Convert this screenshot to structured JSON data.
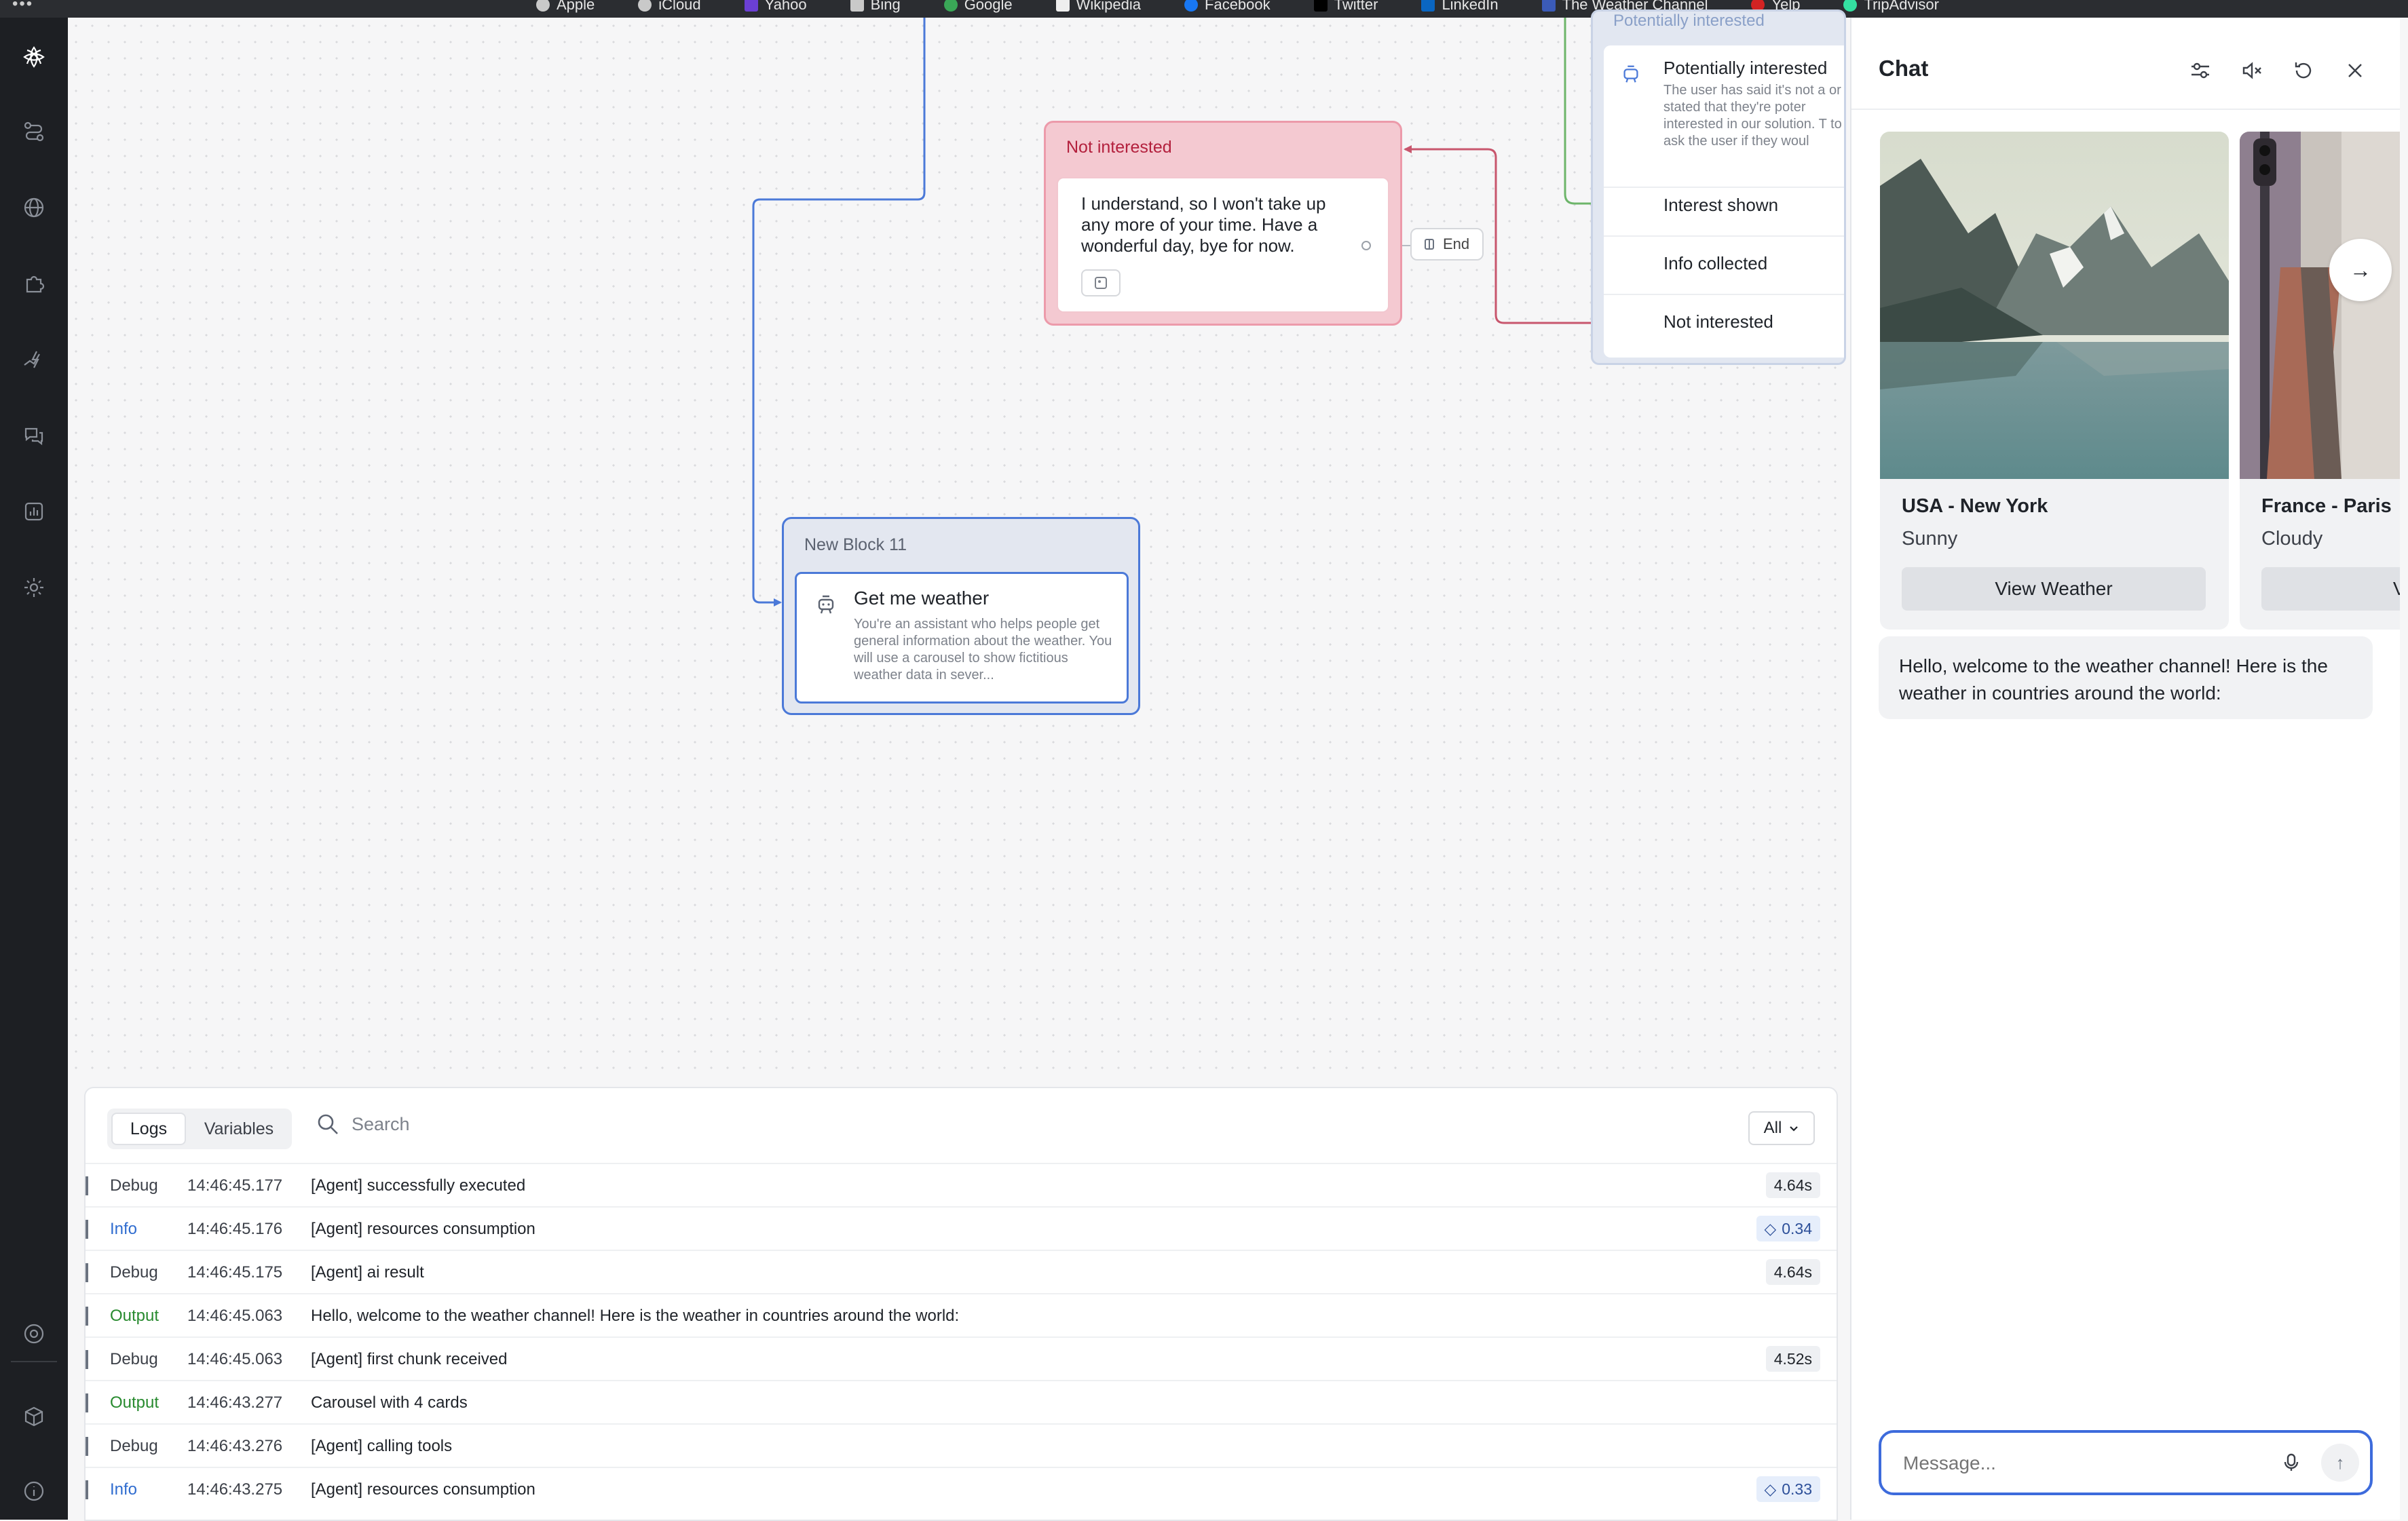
{
  "bookmarks": [
    "Apple",
    "iCloud",
    "Yahoo",
    "Bing",
    "Google",
    "Wikipedia",
    "Facebook",
    "Twitter",
    "LinkedIn",
    "The Weather Channel",
    "Yelp",
    "TripAdvisor"
  ],
  "sidebar": {
    "icons": [
      "logo-icon",
      "flows-icon",
      "globe-icon",
      "puzzle-icon",
      "lightning-icon",
      "chat-bubbles-icon",
      "analytics-icon",
      "settings-icon",
      "help-icon",
      "cube-icon",
      "info-icon"
    ]
  },
  "canvas": {
    "not_interested_block": {
      "title": "Not interested",
      "message": "I understand, so I won't take up any more of your time. Have a wonderful day, bye for now.",
      "end_label": "End"
    },
    "new_block": {
      "title": "New Block 11",
      "agent_name": "Get me weather",
      "agent_description": "You're an assistant who helps people get general information about the weather. You will use a carousel to show fictitious weather data in sever..."
    },
    "right_block": {
      "ghost_title": "Potentially interested",
      "step_title": "Potentially interested",
      "step_description": "The user has said it's not a or stated that they're poter interested in our solution. T to ask the user if they woul",
      "paths": [
        "Interest shown",
        "Info collected",
        "Not interested"
      ]
    }
  },
  "logs": {
    "tabs": [
      "Logs",
      "Variables"
    ],
    "active_tab": "Logs",
    "search_placeholder": "Search",
    "filter_value": "All",
    "rows": [
      {
        "level": "Debug",
        "time": "14:46:45.177",
        "text": "[Agent] successfully executed",
        "badge": "4.64s",
        "badge_type": "time"
      },
      {
        "level": "Info",
        "time": "14:46:45.176",
        "text": "[Agent] resources consumption",
        "badge": "0.34",
        "badge_type": "cost"
      },
      {
        "level": "Debug",
        "time": "14:46:45.175",
        "text": "[Agent] ai result",
        "badge": "4.64s",
        "badge_type": "time"
      },
      {
        "level": "Output",
        "time": "14:46:45.063",
        "text": "Hello, welcome to the weather channel! Here is the weather in countries around the world:",
        "badge": "",
        "badge_type": ""
      },
      {
        "level": "Debug",
        "time": "14:46:45.063",
        "text": "[Agent] first chunk received",
        "badge": "4.52s",
        "badge_type": "time"
      },
      {
        "level": "Output",
        "time": "14:46:43.277",
        "text": "Carousel with 4 cards",
        "badge": "",
        "badge_type": ""
      },
      {
        "level": "Debug",
        "time": "14:46:43.276",
        "text": "[Agent] calling tools",
        "badge": "",
        "badge_type": ""
      },
      {
        "level": "Info",
        "time": "14:46:43.275",
        "text": "[Agent] resources consumption",
        "badge": "0.33",
        "badge_type": "cost"
      }
    ]
  },
  "chat": {
    "title": "Chat",
    "header_icons": [
      "sliders-icon",
      "mute-icon",
      "reset-icon",
      "close-icon"
    ],
    "cards": [
      {
        "city": "USA - New York",
        "condition": "Sunny",
        "button": "View Weather"
      },
      {
        "city": "France - Paris",
        "condition": "Cloudy",
        "button": "View"
      }
    ],
    "welcome_message": "Hello, welcome to the weather channel! Here is the weather in countries around the world:",
    "composer_placeholder": "Message..."
  }
}
